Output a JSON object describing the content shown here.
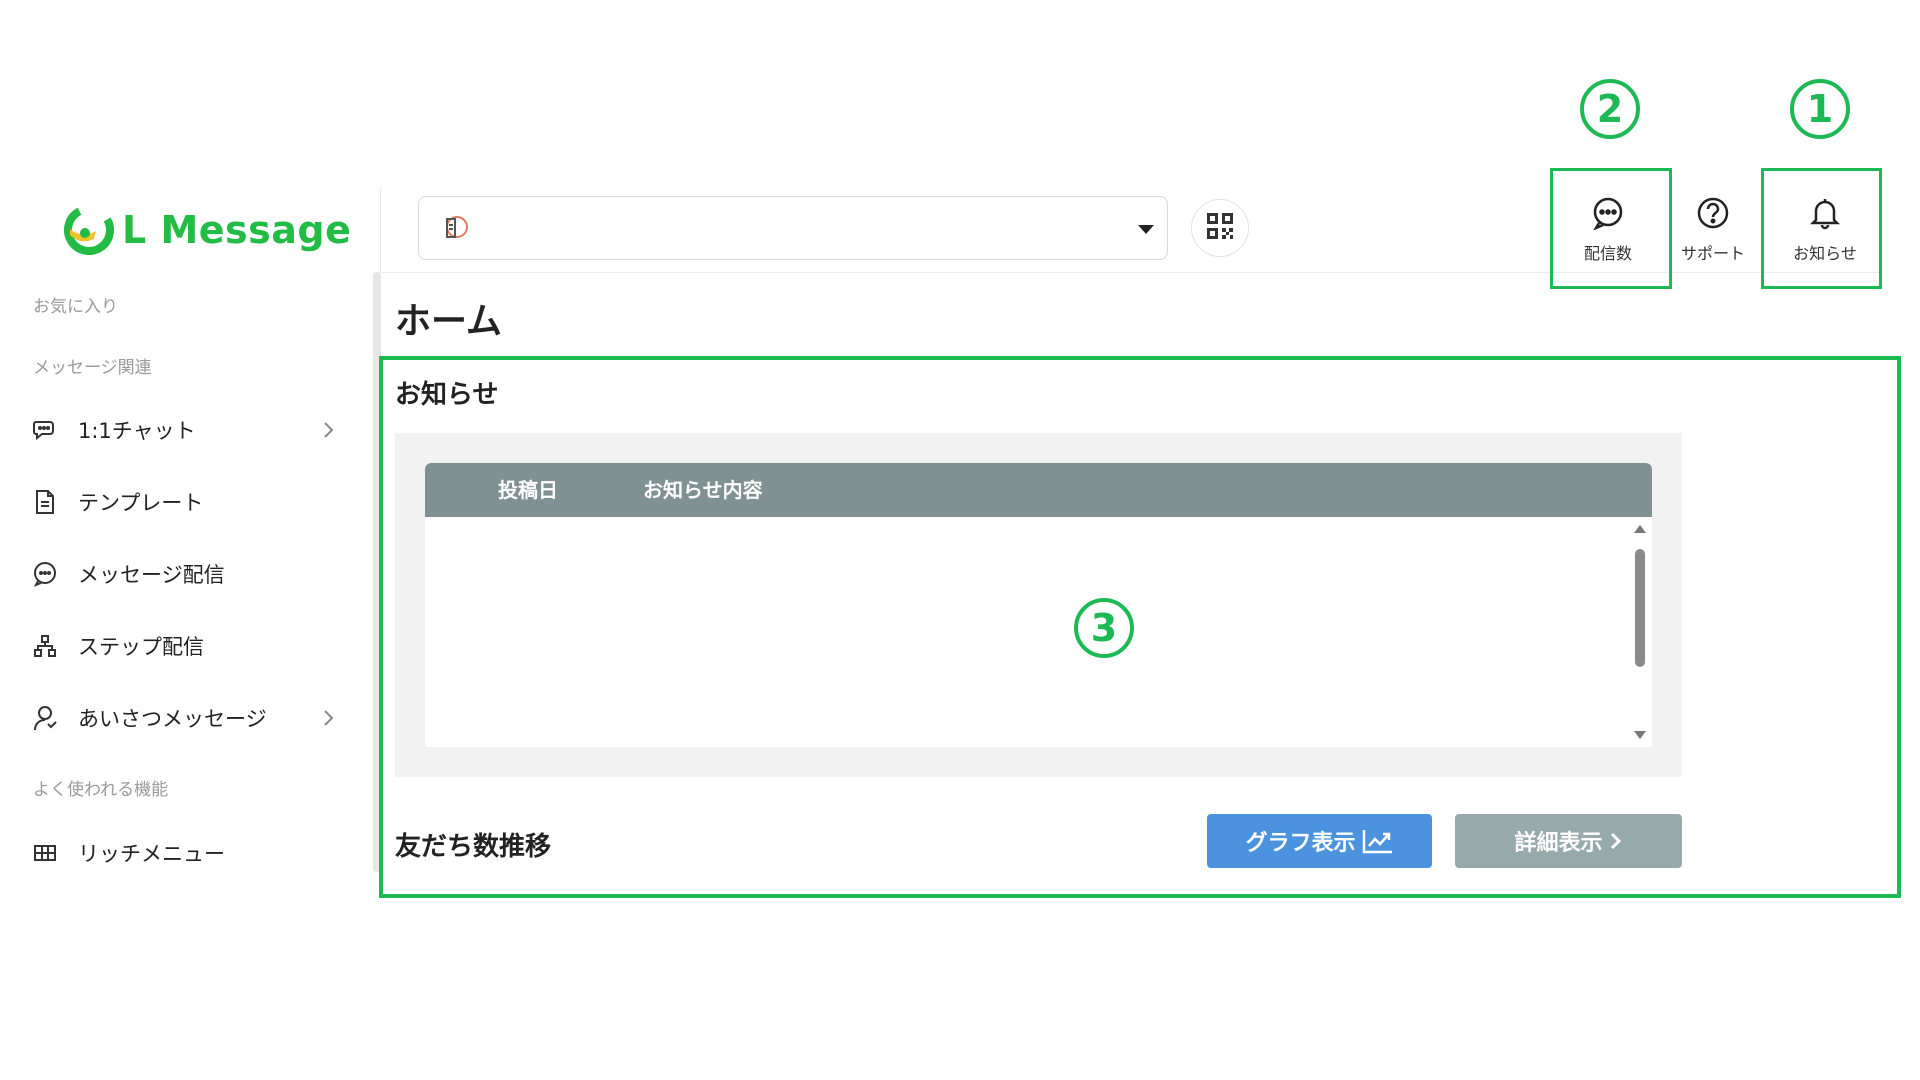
{
  "logo": {
    "text": "L Message"
  },
  "sidebar": {
    "favorites_label": "お気に入り",
    "messages_section_label": "メッセージ関連",
    "items": [
      {
        "label": "1:1チャット",
        "icon": "chat-icon",
        "has_submenu": true
      },
      {
        "label": "テンプレート",
        "icon": "document-icon",
        "has_submenu": false
      },
      {
        "label": "メッセージ配信",
        "icon": "message-icon",
        "has_submenu": false
      },
      {
        "label": "ステップ配信",
        "icon": "sitemap-icon",
        "has_submenu": false
      },
      {
        "label": "あいさつメッセージ",
        "icon": "user-icon",
        "has_submenu": true
      }
    ],
    "frequent_section_label": "よく使われる機能",
    "frequent_items": [
      {
        "label": "リッチメニュー",
        "icon": "grid-icon"
      }
    ]
  },
  "topbar": {
    "account_select_value": "",
    "buttons": {
      "delivery_count": "配信数",
      "support": "サポート",
      "notifications": "お知らせ"
    }
  },
  "annotations": {
    "one": "1",
    "two": "2",
    "three": "3"
  },
  "main": {
    "page_title": "ホーム",
    "news": {
      "heading": "お知らせ",
      "columns": [
        "投稿日",
        "お知らせ内容"
      ],
      "rows": []
    },
    "friends": {
      "heading": "友だち数推移",
      "graph_button": "グラフ表示",
      "detail_button": "詳細表示"
    }
  },
  "colors": {
    "brand_green": "#22bb44",
    "annotation_green": "#1db954",
    "table_header": "#7f9193",
    "graph_button": "#4b93df",
    "detail_button": "#97aaab"
  }
}
